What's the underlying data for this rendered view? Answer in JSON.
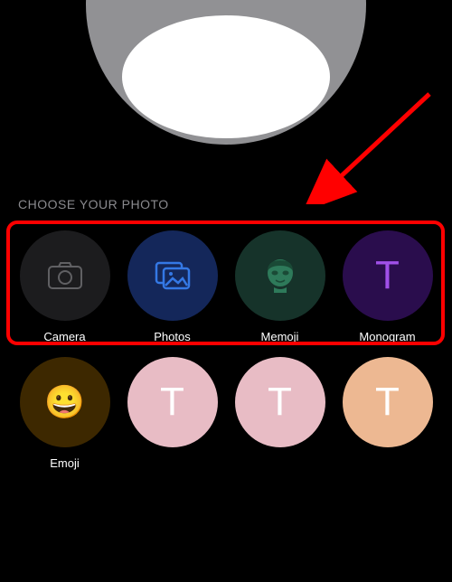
{
  "header": {
    "section_title": "CHOOSE YOUR PHOTO"
  },
  "options": {
    "camera": {
      "label": "Camera"
    },
    "photos": {
      "label": "Photos"
    },
    "memoji": {
      "label": "Memoji"
    },
    "monogram": {
      "label": "Monogram",
      "letter": "T"
    },
    "emoji": {
      "label": "Emoji"
    },
    "suggestion1": {
      "letter": "T"
    },
    "suggestion2": {
      "letter": "T"
    },
    "suggestion3": {
      "letter": "T"
    }
  },
  "colors": {
    "highlight": "#ff0000",
    "arrow": "#ff0000"
  }
}
